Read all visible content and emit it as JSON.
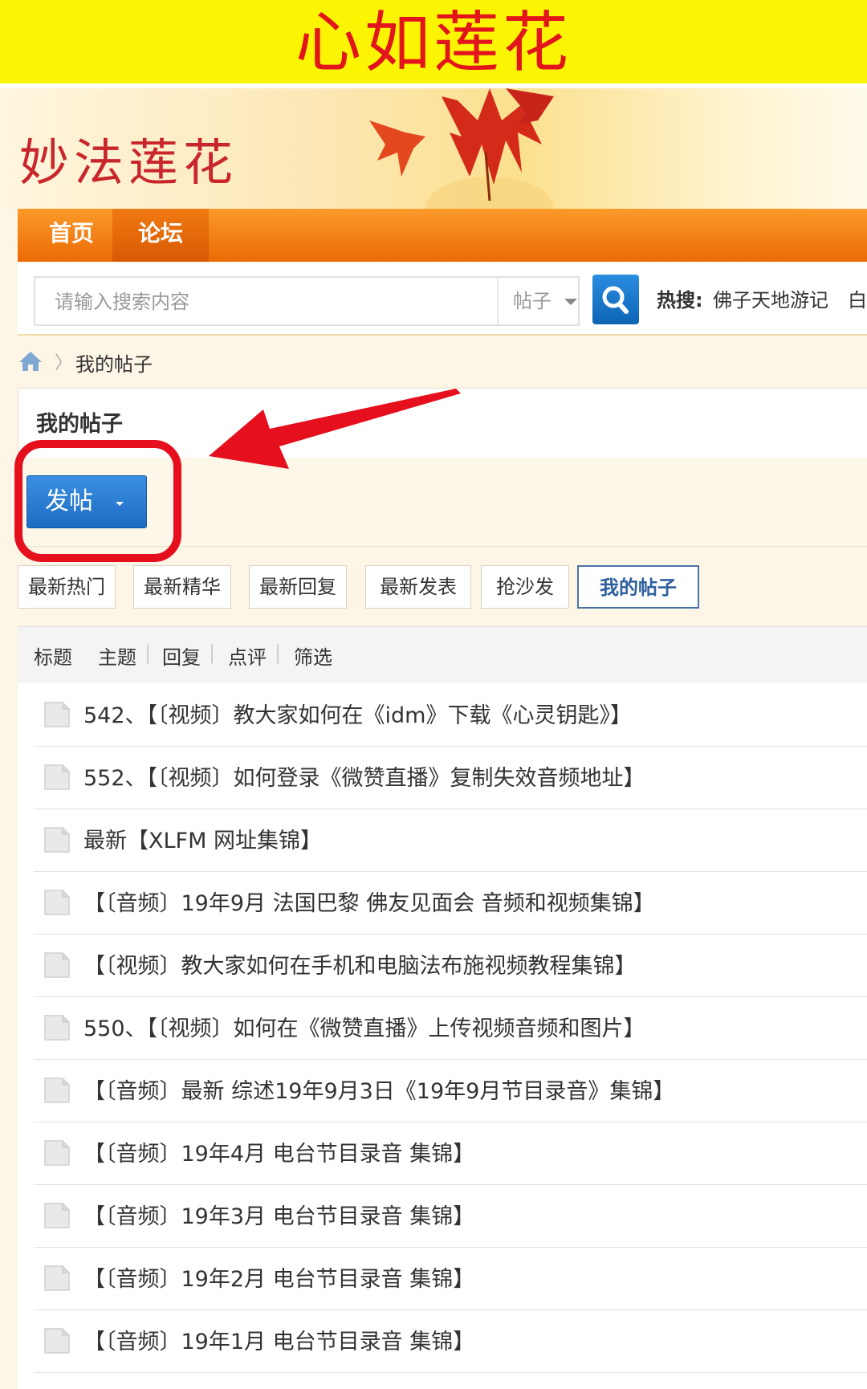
{
  "banner": {
    "title": "心如莲花"
  },
  "header": {
    "logo": "妙法莲花"
  },
  "nav": {
    "home": "首页",
    "forum": "论坛"
  },
  "search": {
    "placeholder": "请输入搜索内容",
    "type": "帖子",
    "hot_label": "热搜:",
    "hot_items": [
      "佛子天地游记",
      "白话"
    ]
  },
  "breadcrumb": {
    "current": "我的帖子"
  },
  "panel": {
    "title": "我的帖子",
    "post_button": "发帖"
  },
  "tabs": [
    "最新热门",
    "最新精华",
    "最新回复",
    "最新发表",
    "抢沙发",
    "我的帖子"
  ],
  "active_tab": "我的帖子",
  "table_header": {
    "title": "标题",
    "theme": "主题",
    "reply": "回复",
    "review": "点评",
    "filter": "筛选"
  },
  "posts": [
    "542、【〔视频〕教大家如何在《idm》下载《心灵钥匙》】",
    "552、【〔视频〕如何登录《微赞直播》复制失效音频地址】",
    "最新【XLFM 网址集锦】",
    "【〔音频〕19年9月 法国巴黎 佛友见面会 音频和视频集锦】",
    "【〔视频〕教大家如何在手机和电脑法布施视频教程集锦】",
    "550、【〔视频〕如何在《微赞直播》上传视频音频和图片】",
    "【〔音频〕最新 综述19年9月3日《19年9月节目录音》集锦】",
    "【〔音频〕19年4月 电台节目录音 集锦】",
    "【〔音频〕19年3月 电台节目录音 集锦】",
    "【〔音频〕19年2月 电台节目录音 集锦】",
    "【〔音频〕19年1月 电台节目录音 集锦】"
  ],
  "colors": {
    "banner_bg": "#fbf504",
    "banner_text": "#e2141c",
    "nav_orange": "#f07a12",
    "post_button": "#1d6cc4",
    "annotation_red": "#e50f1e"
  }
}
